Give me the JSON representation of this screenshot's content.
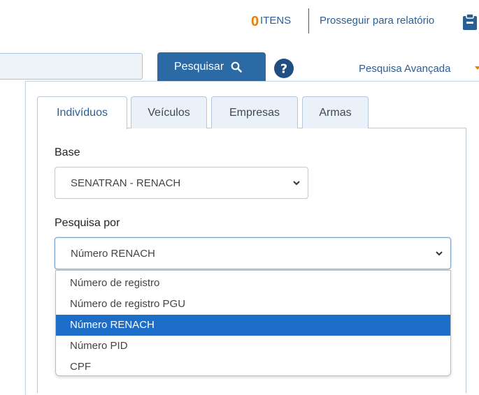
{
  "header": {
    "items_count": "0",
    "items_label": "ITENS",
    "proceed_label": "Prosseguir para relatório",
    "clipboard_icon": "clipboard-icon"
  },
  "search": {
    "input_value": "",
    "button_label": "Pesquisar",
    "button_icon": "search-icon",
    "help_icon": "help-icon",
    "advanced_label": "Pesquisa Avançada"
  },
  "tabs": [
    {
      "label": "Indivíduos",
      "active": true
    },
    {
      "label": "Veículos",
      "active": false
    },
    {
      "label": "Empresas",
      "active": false
    },
    {
      "label": "Armas",
      "active": false
    }
  ],
  "form": {
    "base_label": "Base",
    "base_value": "SENATRAN - RENACH",
    "pesquisa_label": "Pesquisa por",
    "pesquisa_value": "Número RENACH"
  },
  "dropdown": {
    "options": [
      "Número de registro",
      "Número de registro PGU",
      "Número RENACH",
      "Número PID",
      "CPF"
    ],
    "selected_index": 2
  },
  "colors": {
    "accent": "#2b6aa5",
    "highlight": "#1d6ec8",
    "orange": "#e87e04"
  }
}
